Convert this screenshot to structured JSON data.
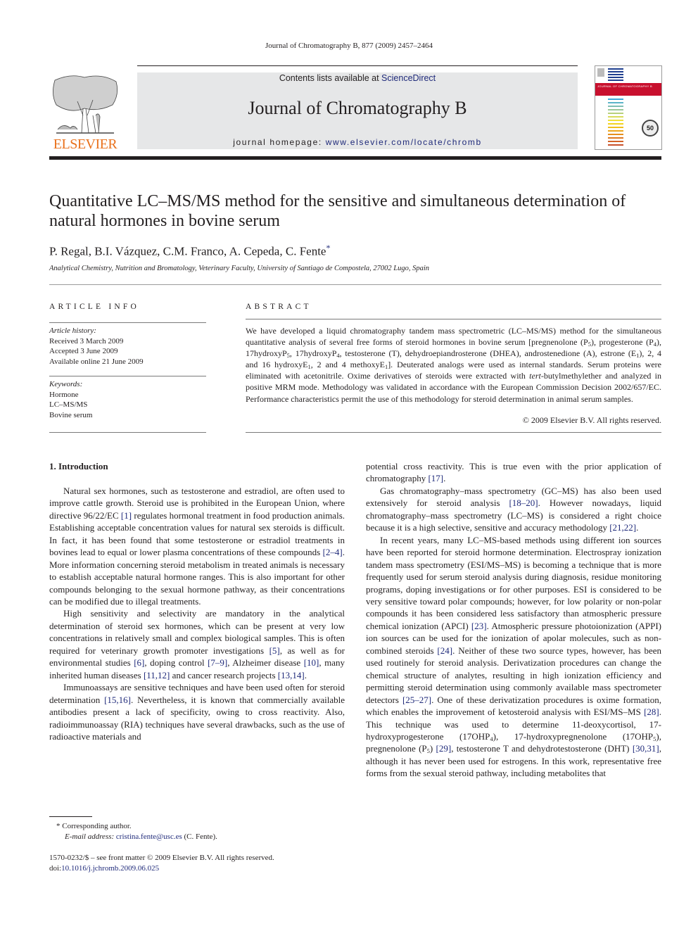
{
  "header": {
    "running_head": "Journal of Chromatography B, 877 (2009) 2457–2464",
    "publisher": "ELSEVIER",
    "contents_prefix": "Contents lists available at ",
    "contents_link": "ScienceDirect",
    "journal_title": "Journal of Chromatography B",
    "homepage_prefix": "journal homepage: ",
    "homepage_link": "www.elsevier.com/locate/chromb",
    "cover_title": "JOURNAL OF CHROMATOGRAPHY B",
    "cover_badge": "50",
    "colors": {
      "accent_link": "#1f2a7a",
      "elsevier_orange": "#e9711c",
      "banner_gray": "#e6e7e8",
      "cover_red": "#c8102e"
    }
  },
  "article": {
    "title": "Quantitative LC–MS/MS method for the sensitive and simultaneous determination of natural hormones in bovine serum",
    "authors": "P. Regal, B.I. Vázquez, C.M. Franco, A. Cepeda, C. Fente",
    "corresponding_mark": "*",
    "affiliation": "Analytical Chemistry, Nutrition and Bromatology, Veterinary Faculty, University of Santiago de Compostela, 27002 Lugo, Spain"
  },
  "article_info": {
    "heading": "ARTICLE INFO",
    "history_label": "Article history:",
    "history": [
      "Received 3 March 2009",
      "Accepted 3 June 2009",
      "Available online 21 June 2009"
    ],
    "keywords_label": "Keywords:",
    "keywords": [
      "Hormone",
      "LC–MS/MS",
      "Bovine serum"
    ]
  },
  "abstract": {
    "heading": "ABSTRACT",
    "p1": "We have developed a liquid chromatography tandem mass spectrometric (LC–MS/MS) method for the simultaneous quantitative analysis of several free forms of steroid hormones in bovine serum [pregnenolone (P",
    "s1": "5",
    "p2": "), progesterone (P",
    "s2": "4",
    "p3": "), 17hydroxyP",
    "s3": "5",
    "p4": ", 17hydroxyP",
    "s4": "4",
    "p5": ", testosterone (T), dehydroepiandrosterone (DHEA), androstenedione (A), estrone (E",
    "s5": "1",
    "p6": "), 2, 4 and 16 hydroxyE",
    "s6": "1",
    "p7": ", 2 and 4 methoxyE",
    "s7": "1",
    "p8": "]. Deuterated analogs were used as internal standards. Serum proteins were eliminated with acetonitrile. Oxime derivatives of steroids were extracted with ",
    "p8_italic": "tert",
    "p9": "-butylmethylether and analyzed in positive MRM mode. Methodology was validated in accordance with the European Commission Decision 2002/657/EC. Performance characteristics permit the use of this methodology for steroid determination in animal serum samples.",
    "copyright": "© 2009 Elsevier B.V. All rights reserved."
  },
  "body": {
    "section_heading": "1.  Introduction",
    "left": {
      "para1": {
        "t1": "Natural sex hormones, such as testosterone and estradiol, are often used to improve cattle growth. Steroid use is prohibited in the European Union, where directive 96/22/EC ",
        "r1": "[1]",
        "t2": " regulates hormonal treatment in food production animals. Establishing acceptable concentration values for natural sex steroids is difficult. In fact, it has been found that some testosterone or estradiol treatments in bovines lead to equal or lower plasma concentrations of these compounds ",
        "r2": "[2–4]",
        "t3": ". More information concerning steroid metabolism in treated animals is necessary to establish acceptable natural hormone ranges. This is also important for other compounds belonging to the sexual hormone pathway, as their concentrations can be modified due to illegal treatments."
      },
      "para2": {
        "t1": "High sensitivity and selectivity are mandatory in the analytical determination of steroid sex hormones, which can be present at very low concentrations in relatively small and complex biological samples. This is often required for veterinary growth promoter investigations ",
        "r1": "[5]",
        "t2": ", as well as for environmental studies ",
        "r2": "[6]",
        "t3": ", doping control ",
        "r3": "[7–9]",
        "t4": ", Alzheimer disease ",
        "r4": "[10]",
        "t5": ", many inherited human diseases ",
        "r5": "[11,12]",
        "t6": " and cancer research projects ",
        "r6": "[13,14]",
        "t7": "."
      },
      "para3": {
        "t1": "Immunoassays are sensitive techniques and have been used often for steroid determination ",
        "r1": "[15,16]",
        "t2": ". Nevertheless, it is known that commercially available antibodies present a lack of specificity, owing to cross reactivity. Also, radioimmunoassay (RIA) techniques have several drawbacks, such as the use of radioactive materials and"
      }
    },
    "right": {
      "para0": {
        "t1": "potential cross reactivity. This is true even with the prior application of chromatography ",
        "r1": "[17]",
        "t2": "."
      },
      "para1": {
        "t1": "Gas chromatography–mass spectrometry (GC–MS) has also been used extensively for steroid analysis ",
        "r1": "[18–20]",
        "t2": ". However nowadays, liquid chromatography–mass spectrometry (LC–MS) is considered a right choice because it is a high selective, sensitive and accuracy methodology ",
        "r2": "[21,22]",
        "t3": "."
      },
      "para2": {
        "t1": "In recent years, many LC–MS-based methods using different ion sources have been reported for steroid hormone determination. Electrospray ionization tandem mass spectrometry (ESI/MS–MS) is becoming a technique that is more frequently used for serum steroid analysis during diagnosis, residue monitoring programs, doping investigations or for other purposes. ESI is considered to be very sensitive toward polar compounds; however, for low polarity or non-polar compounds it has been considered less satisfactory than atmospheric pressure chemical ionization (APCI) ",
        "r1": "[23]",
        "t2": ". Atmospheric pressure photoionization (APPI) ion sources can be used for the ionization of apolar molecules, such as non-combined steroids ",
        "r2": "[24]",
        "t3": ". Neither of these two source types, however, has been used routinely for steroid analysis. Derivatization procedures can change the chemical structure of analytes, resulting in high ionization efficiency and permitting steroid determination using commonly available mass spectrometer detectors ",
        "r3": "[25–27]",
        "t4": ". One of these derivatization procedures is oxime formation, which enables the improvement of ketosteroid analysis with ESI/MS–MS ",
        "r4": "[28]",
        "t5": ". This technique was used to determine 11-deoxycortisol, 17-hydroxyprogesterone (17OHP",
        "s1": "4",
        "t6": "), 17-hydroxypregnenolone (17OHP",
        "s2": "5",
        "t7": "), pregnenolone (P",
        "s3": "5",
        "t8": ") ",
        "r5": "[29]",
        "t9": ", testosterone T and dehydrotestosterone (DHT) ",
        "r6": "[30,31]",
        "t10": ", although it has never been used for estrogens. In this work, representative free forms from the sexual steroid pathway, including metabolites that"
      }
    }
  },
  "footnotes": {
    "corresponding": "*   Corresponding author.",
    "email_label": "E-mail address: ",
    "email": "cristina.fente@usc.es",
    "email_suffix": " (C. Fente).",
    "issn": "1570-0232/$ – see front matter © 2009 Elsevier B.V. All rights reserved.",
    "doi_label": "doi:",
    "doi": "10.1016/j.jchromb.2009.06.025"
  }
}
